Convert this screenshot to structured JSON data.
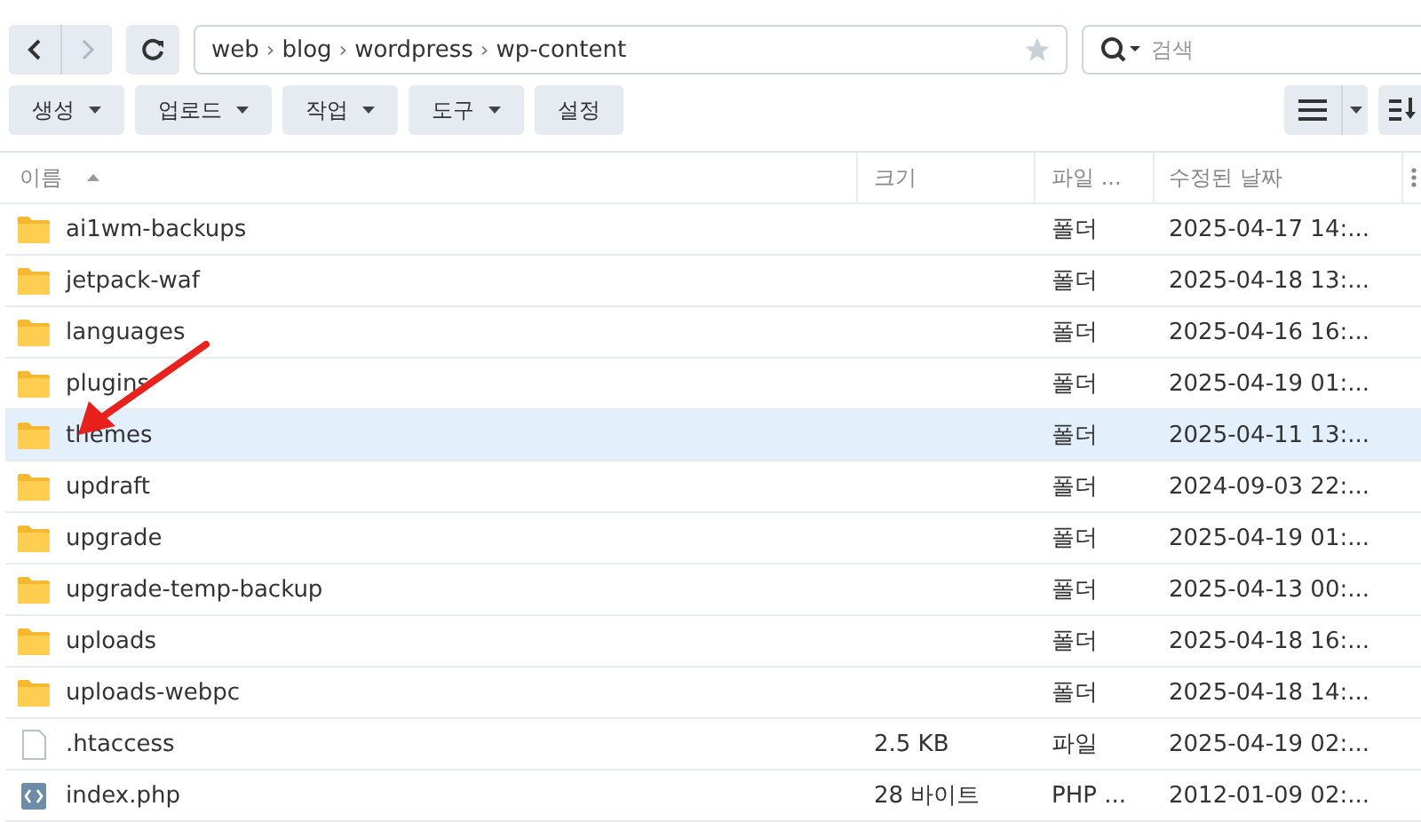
{
  "nav": {
    "back_disabled": false,
    "forward_disabled": true
  },
  "breadcrumb": [
    {
      "label": "web"
    },
    {
      "label": "blog"
    },
    {
      "label": "wordpress"
    },
    {
      "label": "wp-content"
    }
  ],
  "breadcrumb_separator": "›",
  "search": {
    "placeholder": "검색"
  },
  "toolbar": [
    {
      "label": "생성",
      "dropdown": true
    },
    {
      "label": "업로드",
      "dropdown": true
    },
    {
      "label": "작업",
      "dropdown": true
    },
    {
      "label": "도구",
      "dropdown": true
    },
    {
      "label": "설정",
      "dropdown": false
    }
  ],
  "table": {
    "columns": [
      {
        "label": "이름",
        "sorted": true
      },
      {
        "label": "크기",
        "sorted": false
      },
      {
        "label": "파일 ...",
        "sorted": false
      },
      {
        "label": "수정된 날짜",
        "sorted": false
      }
    ],
    "rows": [
      {
        "kind": "folder",
        "name": "ai1wm-backups",
        "size": "",
        "type": "폴더",
        "modified": "2025-04-17 14:...",
        "selected": false
      },
      {
        "kind": "folder",
        "name": "jetpack-waf",
        "size": "",
        "type": "폴더",
        "modified": "2025-04-18 13:...",
        "selected": false
      },
      {
        "kind": "folder",
        "name": "languages",
        "size": "",
        "type": "폴더",
        "modified": "2025-04-16 16:...",
        "selected": false
      },
      {
        "kind": "folder",
        "name": "plugins",
        "size": "",
        "type": "폴더",
        "modified": "2025-04-19 01:...",
        "selected": false
      },
      {
        "kind": "folder",
        "name": "themes",
        "size": "",
        "type": "폴더",
        "modified": "2025-04-11 13:...",
        "selected": true
      },
      {
        "kind": "folder",
        "name": "updraft",
        "size": "",
        "type": "폴더",
        "modified": "2024-09-03 22:...",
        "selected": false
      },
      {
        "kind": "folder",
        "name": "upgrade",
        "size": "",
        "type": "폴더",
        "modified": "2025-04-19 01:...",
        "selected": false
      },
      {
        "kind": "folder",
        "name": "upgrade-temp-backup",
        "size": "",
        "type": "폴더",
        "modified": "2025-04-13 00:...",
        "selected": false
      },
      {
        "kind": "folder",
        "name": "uploads",
        "size": "",
        "type": "폴더",
        "modified": "2025-04-18 16:...",
        "selected": false
      },
      {
        "kind": "folder",
        "name": "uploads-webpc",
        "size": "",
        "type": "폴더",
        "modified": "2025-04-18 14:...",
        "selected": false
      },
      {
        "kind": "file",
        "name": ".htaccess",
        "size": "2.5 KB",
        "type": "파일",
        "modified": "2025-04-19 02:...",
        "selected": false
      },
      {
        "kind": "code",
        "name": "index.php",
        "size": "28 바이트",
        "type": "PHP ...",
        "modified": "2012-01-09 02:...",
        "selected": false
      }
    ]
  }
}
